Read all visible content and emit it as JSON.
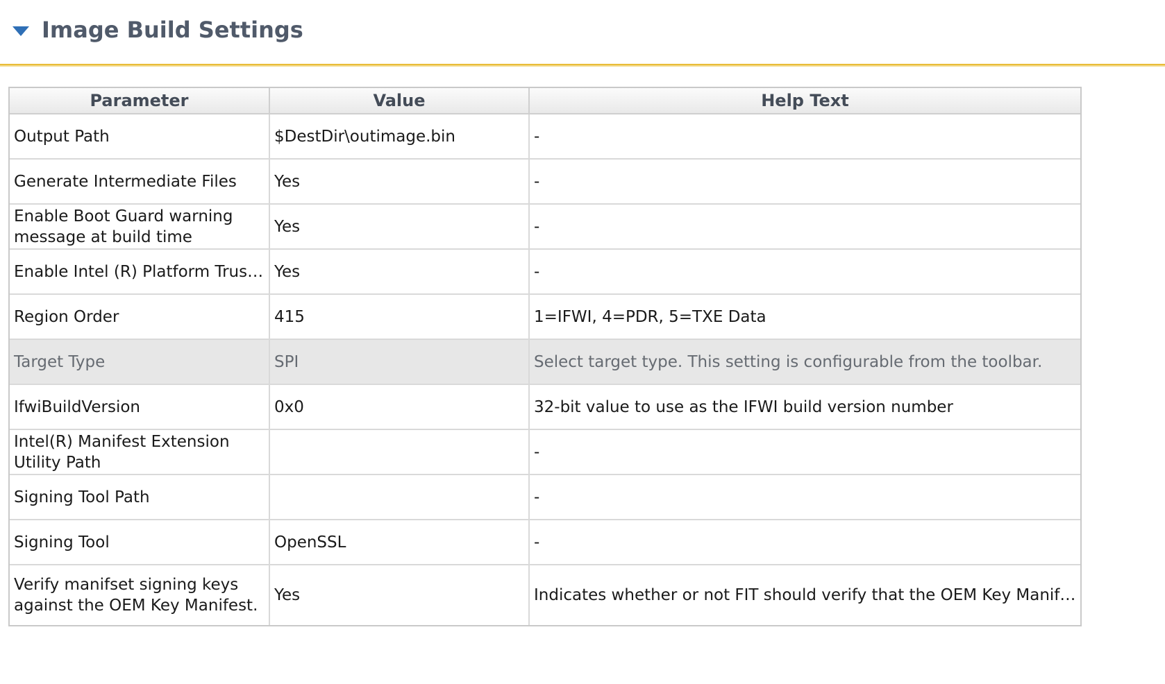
{
  "section": {
    "title": "Image Build Settings"
  },
  "colors": {
    "accent_rule": "#e9bd38",
    "toggle": "#2f6fb6",
    "selected_row": "#e7e7e7"
  },
  "table": {
    "headers": [
      "Parameter",
      "Value",
      "Help Text"
    ],
    "rows": [
      {
        "parameter": "Output Path",
        "value": "$DestDir\\outimage.bin",
        "help": "-"
      },
      {
        "parameter": "Generate Intermediate Files",
        "value": "Yes",
        "help": "-"
      },
      {
        "parameter": "Enable Boot Guard warning message at build time",
        "value": "Yes",
        "help": "-"
      },
      {
        "parameter": "Enable Intel (R) Platform Trust ...",
        "value": "Yes",
        "help": "-"
      },
      {
        "parameter": "Region Order",
        "value": "415",
        "help": "1=IFWI, 4=PDR, 5=TXE Data"
      },
      {
        "parameter": "Target Type",
        "value": "SPI",
        "help": "Select target type. This setting is configurable from the toolbar."
      },
      {
        "parameter": "IfwiBuildVersion",
        "value": "0x0",
        "help": "32-bit value to use as the IFWI build version number"
      },
      {
        "parameter": "Intel(R) Manifest Extension Utility Path",
        "value": "",
        "help": "-"
      },
      {
        "parameter": "Signing Tool Path",
        "value": "",
        "help": "-"
      },
      {
        "parameter": "Signing Tool",
        "value": "OpenSSL",
        "help": "-"
      },
      {
        "parameter": "Verify manifset signing keys against the OEM Key Manifest.",
        "value": "Yes",
        "help": "Indicates whether or not FIT should verify that the OEM Key Manifest c..."
      }
    ]
  }
}
